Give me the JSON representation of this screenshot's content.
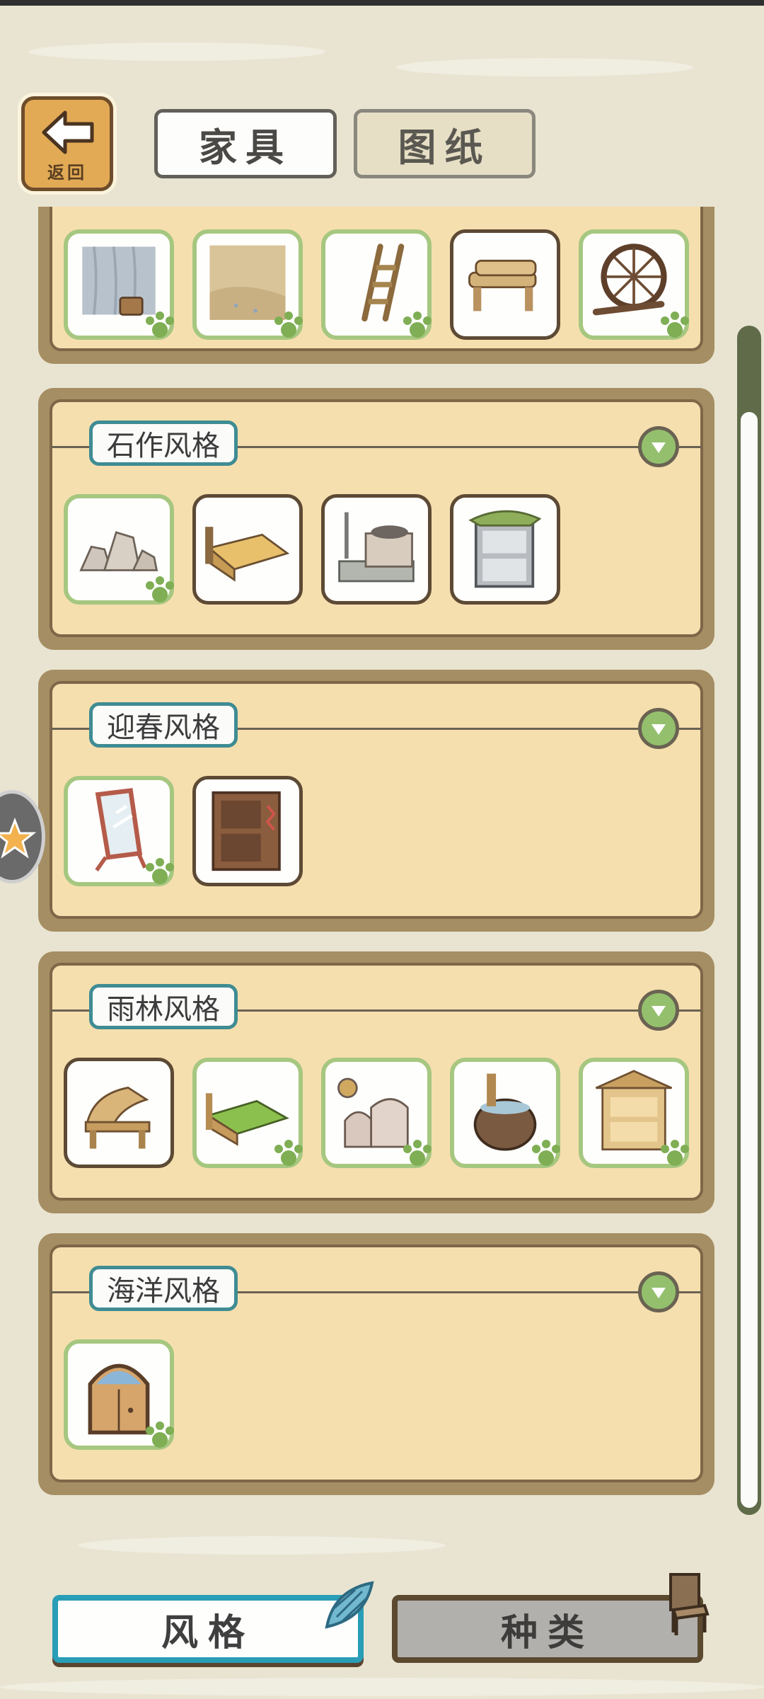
{
  "header": {
    "back_label": "返回",
    "tabs": [
      "家具",
      "图纸"
    ]
  },
  "sections": [
    {
      "title": "",
      "items": [
        "waterfall-bucket",
        "sand-ground",
        "wooden-ladder",
        "log-bench",
        "round-window"
      ]
    },
    {
      "title": "石作风格",
      "items": [
        "stone-rocks",
        "stone-bed",
        "stone-stove",
        "leaf-shelf"
      ]
    },
    {
      "title": "迎春风格",
      "items": [
        "standing-mirror",
        "wooden-cabinet"
      ]
    },
    {
      "title": "雨林风格",
      "items": [
        "bamboo-chair",
        "bamboo-bed",
        "clay-oven",
        "water-jar",
        "bamboo-house-shelf"
      ]
    },
    {
      "title": "海洋风格",
      "items": [
        "arched-door"
      ]
    }
  ],
  "bottom": {
    "style_label": "风格",
    "type_label": "种类"
  },
  "colors": {
    "background": "#e9e4d1",
    "panel": "#f6dfae",
    "frame": "#a58e63",
    "accent_teal": "#2a9db7",
    "owned_green": "#a6c780"
  }
}
